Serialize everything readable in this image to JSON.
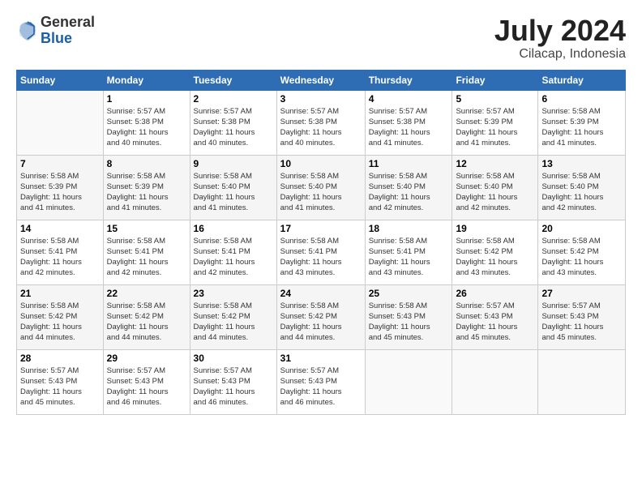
{
  "header": {
    "logo_general": "General",
    "logo_blue": "Blue",
    "month_title": "July 2024",
    "subtitle": "Cilacap, Indonesia"
  },
  "days_of_week": [
    "Sunday",
    "Monday",
    "Tuesday",
    "Wednesday",
    "Thursday",
    "Friday",
    "Saturday"
  ],
  "weeks": [
    [
      {
        "day": "",
        "info": ""
      },
      {
        "day": "1",
        "info": "Sunrise: 5:57 AM\nSunset: 5:38 PM\nDaylight: 11 hours\nand 40 minutes."
      },
      {
        "day": "2",
        "info": "Sunrise: 5:57 AM\nSunset: 5:38 PM\nDaylight: 11 hours\nand 40 minutes."
      },
      {
        "day": "3",
        "info": "Sunrise: 5:57 AM\nSunset: 5:38 PM\nDaylight: 11 hours\nand 40 minutes."
      },
      {
        "day": "4",
        "info": "Sunrise: 5:57 AM\nSunset: 5:38 PM\nDaylight: 11 hours\nand 41 minutes."
      },
      {
        "day": "5",
        "info": "Sunrise: 5:57 AM\nSunset: 5:39 PM\nDaylight: 11 hours\nand 41 minutes."
      },
      {
        "day": "6",
        "info": "Sunrise: 5:58 AM\nSunset: 5:39 PM\nDaylight: 11 hours\nand 41 minutes."
      }
    ],
    [
      {
        "day": "7",
        "info": "Sunrise: 5:58 AM\nSunset: 5:39 PM\nDaylight: 11 hours\nand 41 minutes."
      },
      {
        "day": "8",
        "info": "Sunrise: 5:58 AM\nSunset: 5:39 PM\nDaylight: 11 hours\nand 41 minutes."
      },
      {
        "day": "9",
        "info": "Sunrise: 5:58 AM\nSunset: 5:40 PM\nDaylight: 11 hours\nand 41 minutes."
      },
      {
        "day": "10",
        "info": "Sunrise: 5:58 AM\nSunset: 5:40 PM\nDaylight: 11 hours\nand 41 minutes."
      },
      {
        "day": "11",
        "info": "Sunrise: 5:58 AM\nSunset: 5:40 PM\nDaylight: 11 hours\nand 42 minutes."
      },
      {
        "day": "12",
        "info": "Sunrise: 5:58 AM\nSunset: 5:40 PM\nDaylight: 11 hours\nand 42 minutes."
      },
      {
        "day": "13",
        "info": "Sunrise: 5:58 AM\nSunset: 5:40 PM\nDaylight: 11 hours\nand 42 minutes."
      }
    ],
    [
      {
        "day": "14",
        "info": "Sunrise: 5:58 AM\nSunset: 5:41 PM\nDaylight: 11 hours\nand 42 minutes."
      },
      {
        "day": "15",
        "info": "Sunrise: 5:58 AM\nSunset: 5:41 PM\nDaylight: 11 hours\nand 42 minutes."
      },
      {
        "day": "16",
        "info": "Sunrise: 5:58 AM\nSunset: 5:41 PM\nDaylight: 11 hours\nand 42 minutes."
      },
      {
        "day": "17",
        "info": "Sunrise: 5:58 AM\nSunset: 5:41 PM\nDaylight: 11 hours\nand 43 minutes."
      },
      {
        "day": "18",
        "info": "Sunrise: 5:58 AM\nSunset: 5:41 PM\nDaylight: 11 hours\nand 43 minutes."
      },
      {
        "day": "19",
        "info": "Sunrise: 5:58 AM\nSunset: 5:42 PM\nDaylight: 11 hours\nand 43 minutes."
      },
      {
        "day": "20",
        "info": "Sunrise: 5:58 AM\nSunset: 5:42 PM\nDaylight: 11 hours\nand 43 minutes."
      }
    ],
    [
      {
        "day": "21",
        "info": "Sunrise: 5:58 AM\nSunset: 5:42 PM\nDaylight: 11 hours\nand 44 minutes."
      },
      {
        "day": "22",
        "info": "Sunrise: 5:58 AM\nSunset: 5:42 PM\nDaylight: 11 hours\nand 44 minutes."
      },
      {
        "day": "23",
        "info": "Sunrise: 5:58 AM\nSunset: 5:42 PM\nDaylight: 11 hours\nand 44 minutes."
      },
      {
        "day": "24",
        "info": "Sunrise: 5:58 AM\nSunset: 5:42 PM\nDaylight: 11 hours\nand 44 minutes."
      },
      {
        "day": "25",
        "info": "Sunrise: 5:58 AM\nSunset: 5:43 PM\nDaylight: 11 hours\nand 45 minutes."
      },
      {
        "day": "26",
        "info": "Sunrise: 5:57 AM\nSunset: 5:43 PM\nDaylight: 11 hours\nand 45 minutes."
      },
      {
        "day": "27",
        "info": "Sunrise: 5:57 AM\nSunset: 5:43 PM\nDaylight: 11 hours\nand 45 minutes."
      }
    ],
    [
      {
        "day": "28",
        "info": "Sunrise: 5:57 AM\nSunset: 5:43 PM\nDaylight: 11 hours\nand 45 minutes."
      },
      {
        "day": "29",
        "info": "Sunrise: 5:57 AM\nSunset: 5:43 PM\nDaylight: 11 hours\nand 46 minutes."
      },
      {
        "day": "30",
        "info": "Sunrise: 5:57 AM\nSunset: 5:43 PM\nDaylight: 11 hours\nand 46 minutes."
      },
      {
        "day": "31",
        "info": "Sunrise: 5:57 AM\nSunset: 5:43 PM\nDaylight: 11 hours\nand 46 minutes."
      },
      {
        "day": "",
        "info": ""
      },
      {
        "day": "",
        "info": ""
      },
      {
        "day": "",
        "info": ""
      }
    ]
  ]
}
